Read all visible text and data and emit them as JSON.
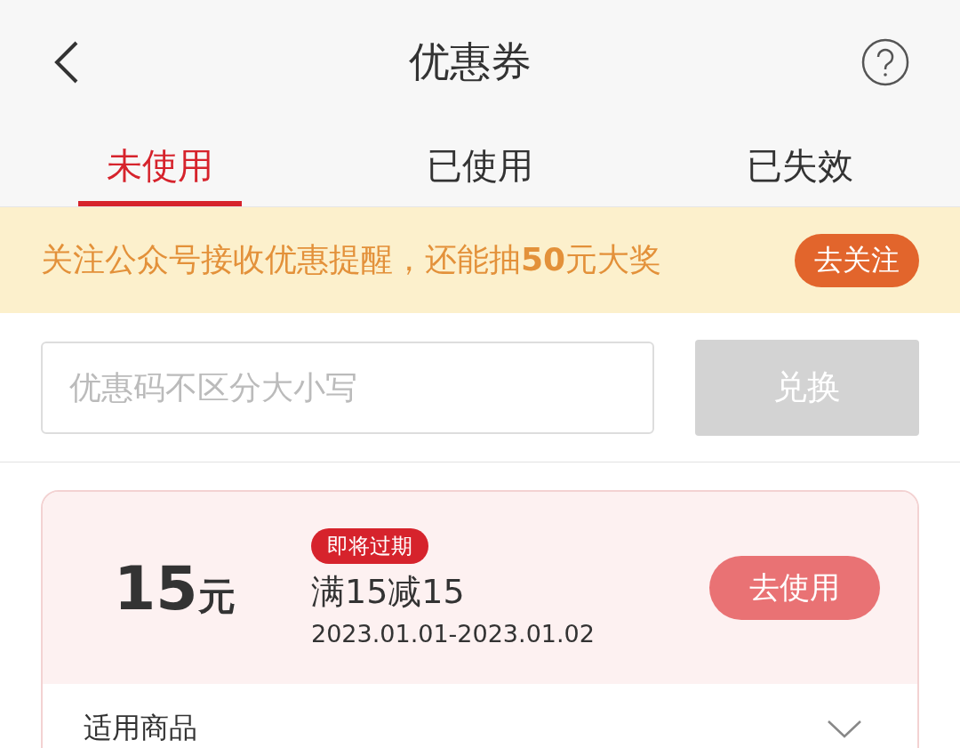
{
  "header": {
    "title": "优惠券"
  },
  "tabs": [
    {
      "label": "未使用",
      "selected": true
    },
    {
      "label": "已使用",
      "selected": false
    },
    {
      "label": "已失效",
      "selected": false
    }
  ],
  "banner": {
    "text": "关注公众号接收优惠提醒，还能抽**50**元大奖",
    "button": "去关注"
  },
  "redeem": {
    "placeholder": "优惠码不区分大小写",
    "button": "兑换",
    "disabled": true
  },
  "coupons": [
    {
      "amount": "15",
      "unit": "元",
      "tag": "即将过期",
      "title": "满15减15",
      "dates": "2023.01.01-2023.01.02",
      "button": "去使用",
      "scope": "适用商品",
      "expanded": false
    }
  ]
}
